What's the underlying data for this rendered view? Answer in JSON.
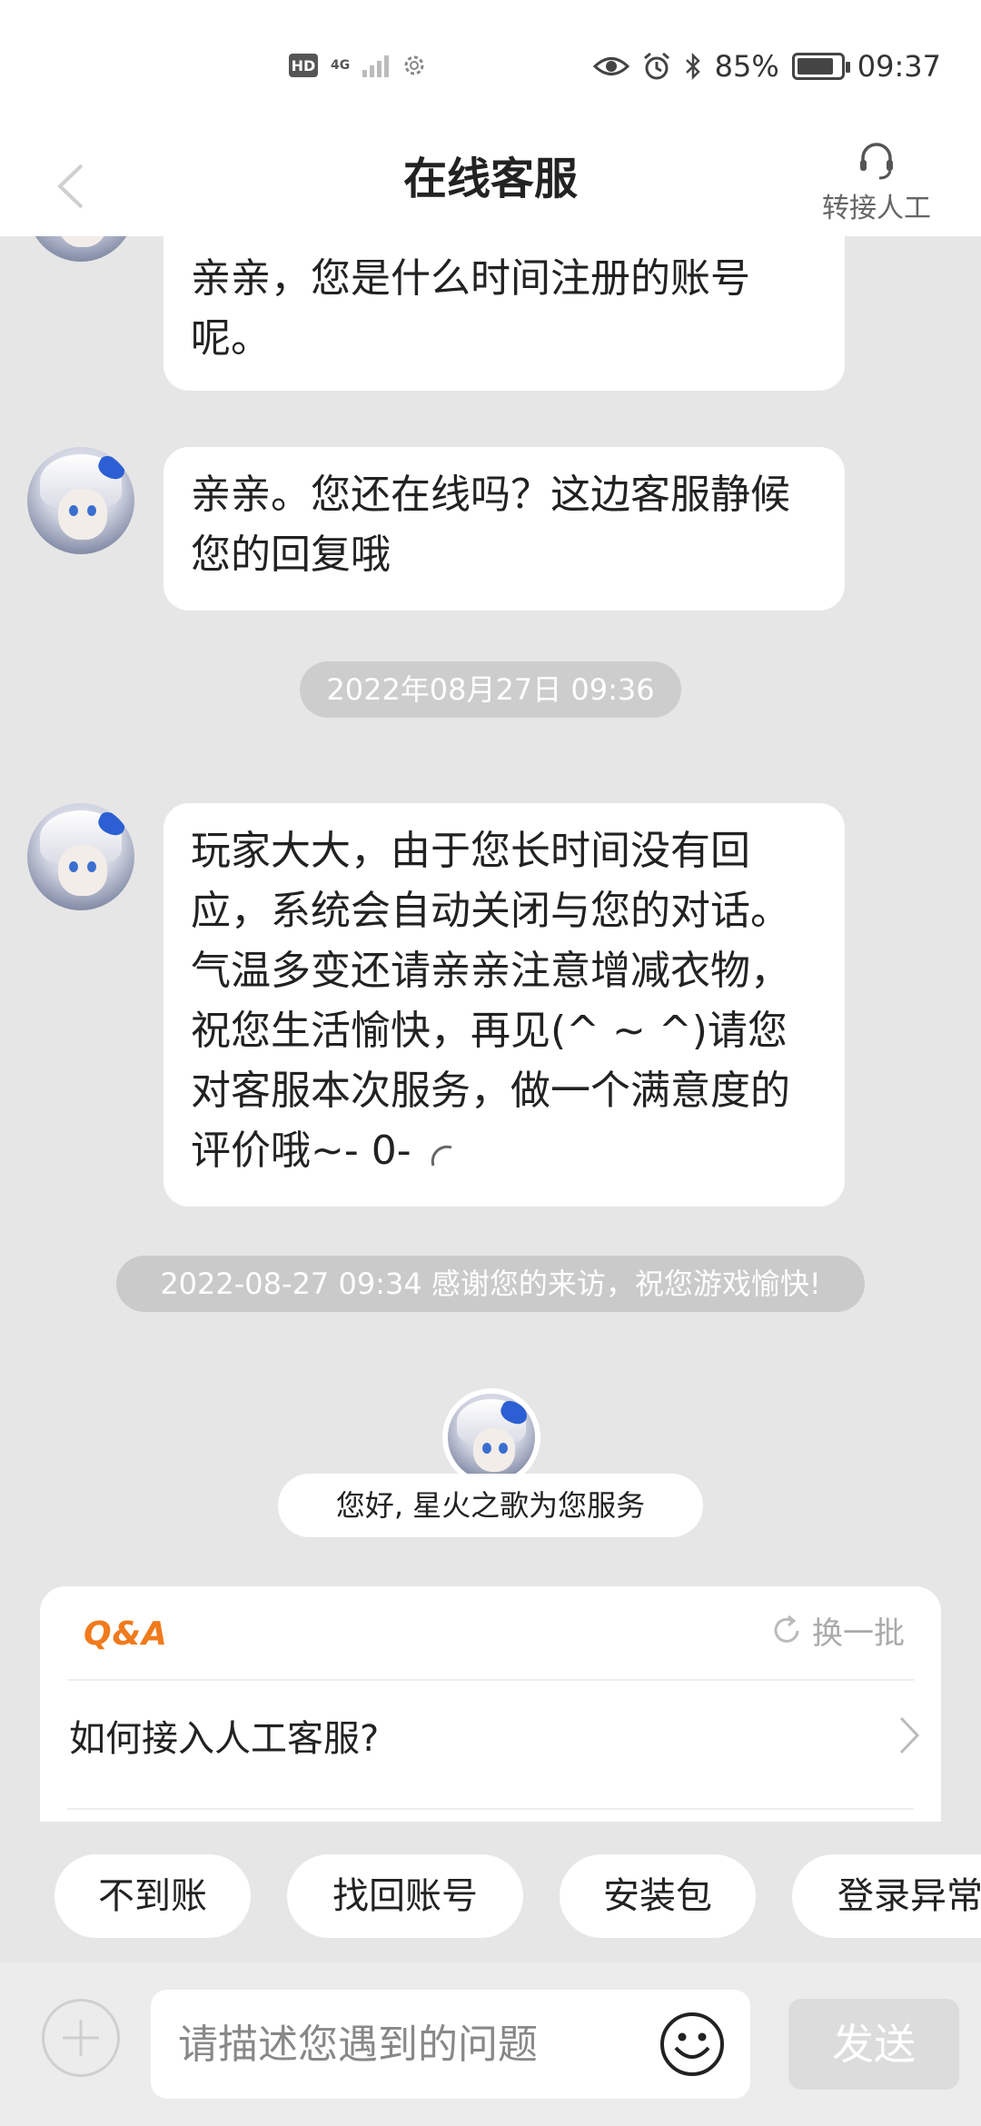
{
  "status_bar": {
    "hd": "HD",
    "network": "4G",
    "battery": "85%",
    "battery_level": 0.85,
    "time": "09:37"
  },
  "header": {
    "title": "在线客服",
    "transfer_label": "转接人工"
  },
  "messages": [
    {
      "text": "亲亲，您是什么时间注册的账号呢。"
    },
    {
      "text": "亲亲。您还在线吗？这边客服静候您的回复哦"
    },
    {
      "text": "玩家大大，由于您长时间没有回应，系统会自动关闭与您的对话。气温多变还请亲亲注意增减衣物，祝您生活愉快，再见(^ ~ ^)请您对客服本次服务，做一个满意度的评价哦~- 0-"
    }
  ],
  "time_pill": "2022年08月27日 09:36",
  "system_notice": "2022-08-27 09:34 感谢您的来访，祝您游戏愉快!",
  "greeting": "您好, 星火之歌为您服务",
  "qa": {
    "logo": "Q&A",
    "refresh_label": "换一批",
    "question": "如何接入人工客服?"
  },
  "chips": [
    "不到账",
    "找回账号",
    "安装包",
    "登录异常"
  ],
  "input": {
    "placeholder": "请描述您遇到的问题",
    "send_label": "发送"
  }
}
